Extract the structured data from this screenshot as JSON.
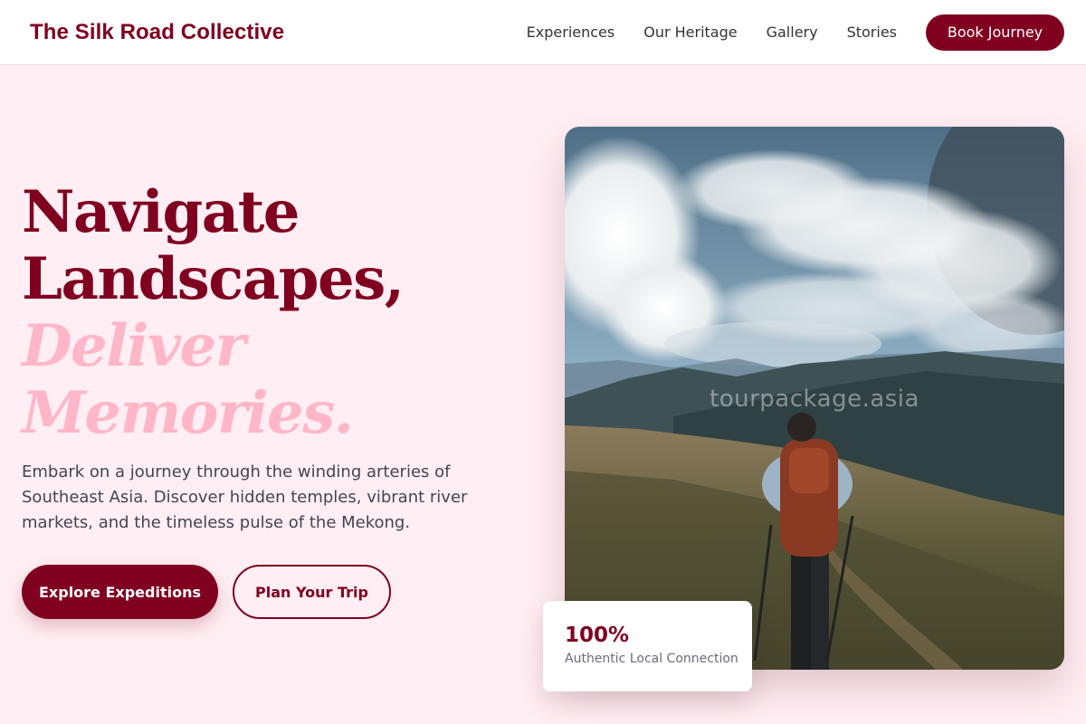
{
  "header": {
    "brand": "The Silk Road Collective",
    "nav": [
      "Experiences",
      "Our Heritage",
      "Gallery",
      "Stories"
    ],
    "cta": "Book Journey"
  },
  "hero": {
    "title_line1": "Navigate",
    "title_line2": "Landscapes,",
    "accent_line1": "Deliver",
    "accent_line2": "Memories.",
    "description": "Embark on a journey through the winding arteries of Southeast Asia. Discover hidden temples, vibrant river markets, and the timeless pulse of the Mekong.",
    "primary_button": "Explore Expeditions",
    "secondary_button": "Plan Your Trip"
  },
  "image": {
    "watermark": "tourpackage.asia"
  },
  "stat": {
    "value": "100%",
    "label": "Authentic Local Connection"
  },
  "colors": {
    "brand": "#800020",
    "accent": "#FFB6C8",
    "background": "#FFEEF3"
  }
}
